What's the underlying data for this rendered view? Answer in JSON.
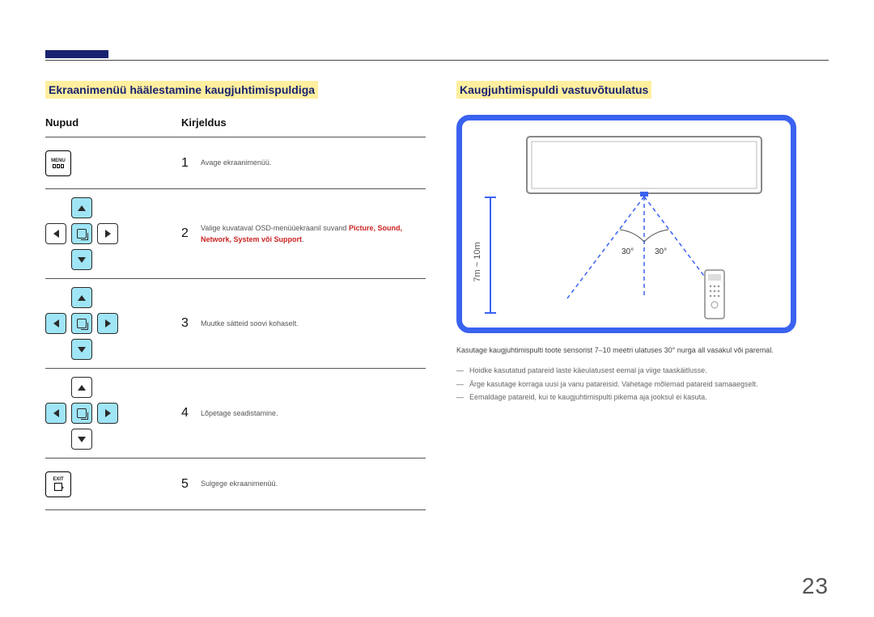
{
  "page_number": "23",
  "left": {
    "heading": "Ekraanimenüü häälestamine kaugjuhtimispuldiga",
    "th_buttons": "Nupud",
    "th_desc": "Kirjeldus",
    "rows": [
      {
        "num": "1",
        "desc_pre": "Avage ekraanimenüü.",
        "desc_hl": "",
        "desc_post": "",
        "icon": "menu"
      },
      {
        "num": "2",
        "desc_pre": "Valige kuvataval OSD-menüüekraanil suvand ",
        "desc_hl": "Picture, Sound, Network, System või Support",
        "desc_post": ".",
        "icon": "dpad-ud"
      },
      {
        "num": "3",
        "desc_pre": "Muutke sätteid soovi kohaselt.",
        "desc_hl": "",
        "desc_post": "",
        "icon": "dpad-all"
      },
      {
        "num": "4",
        "desc_pre": "Lõpetage seadistamine.",
        "desc_hl": "",
        "desc_post": "",
        "icon": "dpad-lr"
      },
      {
        "num": "5",
        "desc_pre": "Sulgege ekraanimenüü.",
        "desc_hl": "",
        "desc_post": "",
        "icon": "exit"
      }
    ],
    "menu_label": "MENU",
    "exit_label": "EXIT"
  },
  "right": {
    "heading": "Kaugjuhtimispuldi vastuvõtuulatus",
    "diagram": {
      "distance_label": "7m ~ 10m",
      "angle_left": "30°",
      "angle_right": "30°"
    },
    "caption": "Kasutage kaugjuhtimispulti toote sensorist 7–10 meetri ulatuses 30° nurga all vasakul või paremal.",
    "notes": [
      "Hoidke kasutatud patareid laste käeulatusest eemal ja viige taaskäitlusse.",
      "Ärge kasutage korraga uusi ja vanu patareisid. Vahetage mõlemad patareid samaaegselt.",
      "Eemaldage patareid, kui te kaugjuhtimispulti pikema aja jooksul ei kasuta."
    ]
  }
}
